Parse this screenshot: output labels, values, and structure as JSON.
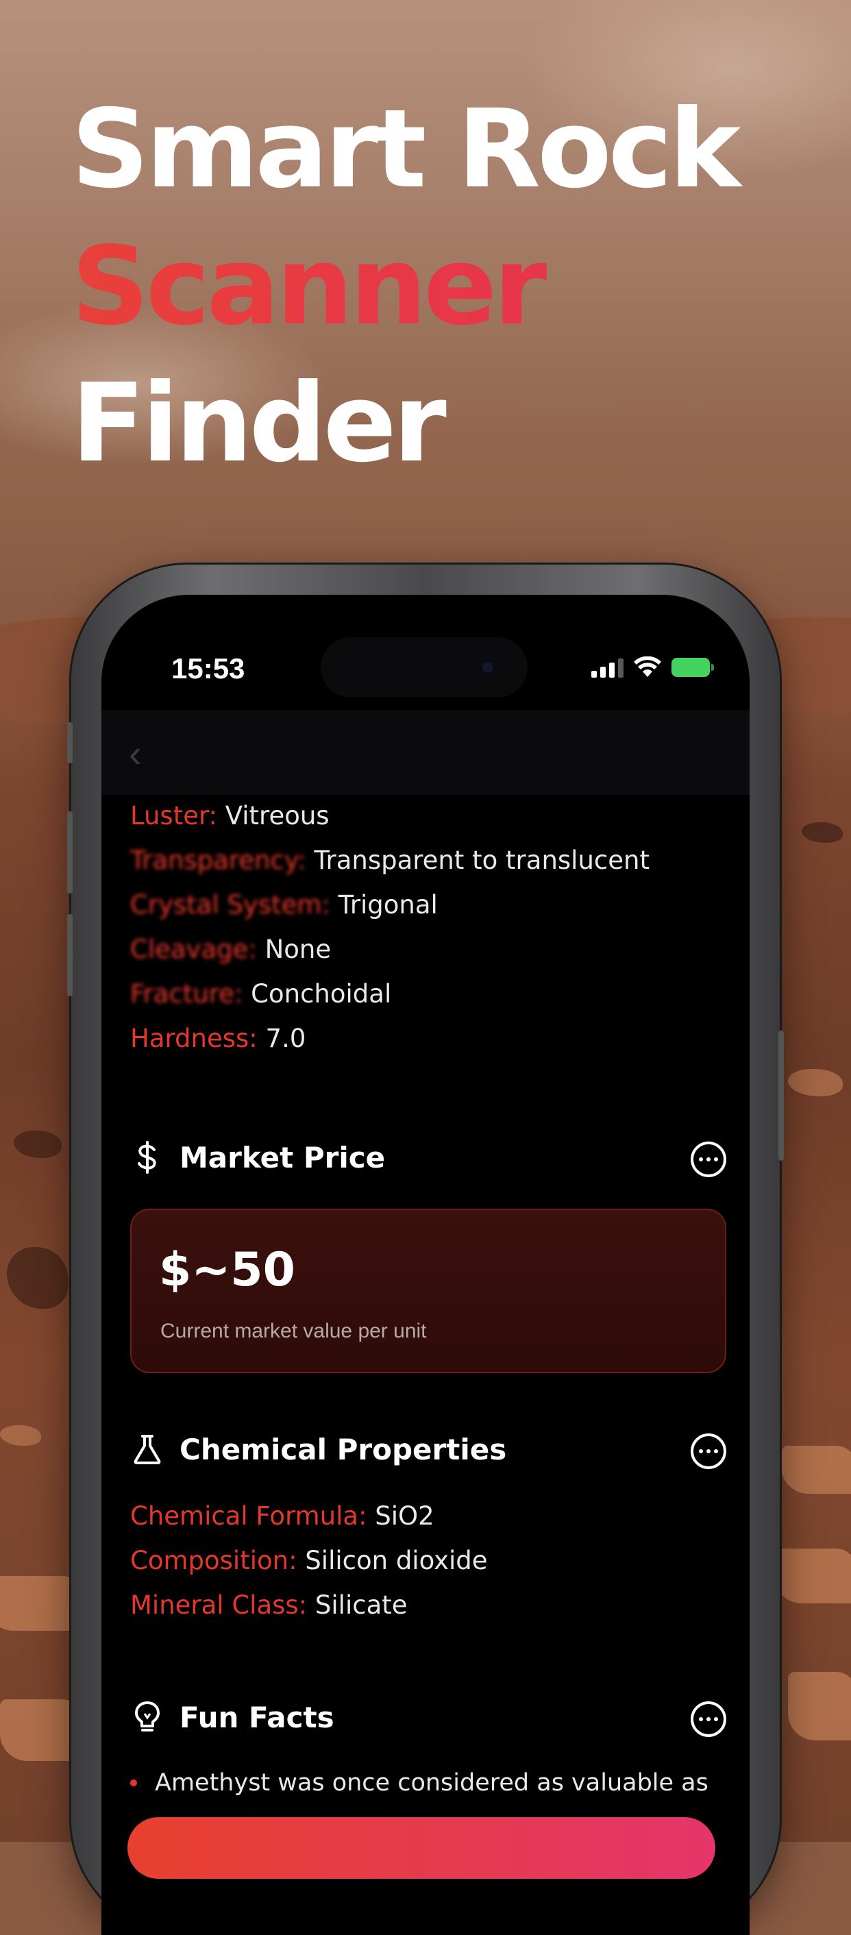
{
  "headline": {
    "line1": "Smart Rock",
    "line2": "Scanner",
    "line3": "Finder"
  },
  "status_bar": {
    "time": "15:53"
  },
  "properties": [
    {
      "key": "Luster:",
      "value": " Vitreous"
    },
    {
      "key": "Transparency:",
      "value": " Transparent to translucent"
    },
    {
      "key": "Crystal System:",
      "value": " Trigonal"
    },
    {
      "key": "Cleavage:",
      "value": " None"
    },
    {
      "key": "Fracture:",
      "value": " Conchoidal"
    },
    {
      "key": "Hardness:",
      "value": " 7.0"
    }
  ],
  "market_price": {
    "title": "Market Price",
    "value": "$~50",
    "subtitle": "Current market value per unit"
  },
  "chemical": {
    "title": "Chemical Properties",
    "items": [
      {
        "key": "Chemical Formula:",
        "value": " SiO2"
      },
      {
        "key": "Composition:",
        "value": " Silicon dioxide"
      },
      {
        "key": "Mineral Class:",
        "value": " Silicate"
      }
    ]
  },
  "fun_facts": {
    "title": "Fun Facts",
    "items": [
      "Amethyst was once considered as valuable as"
    ]
  },
  "colors": {
    "accent": "#e6372c",
    "headline_red": "#ea3b35",
    "card_bg": "#2d0b09"
  },
  "icons": {
    "market": "dollar-icon",
    "chemical": "flask-icon",
    "fun_facts": "lightbulb-icon",
    "more": "more-icon",
    "back": "chevron-left-icon"
  }
}
